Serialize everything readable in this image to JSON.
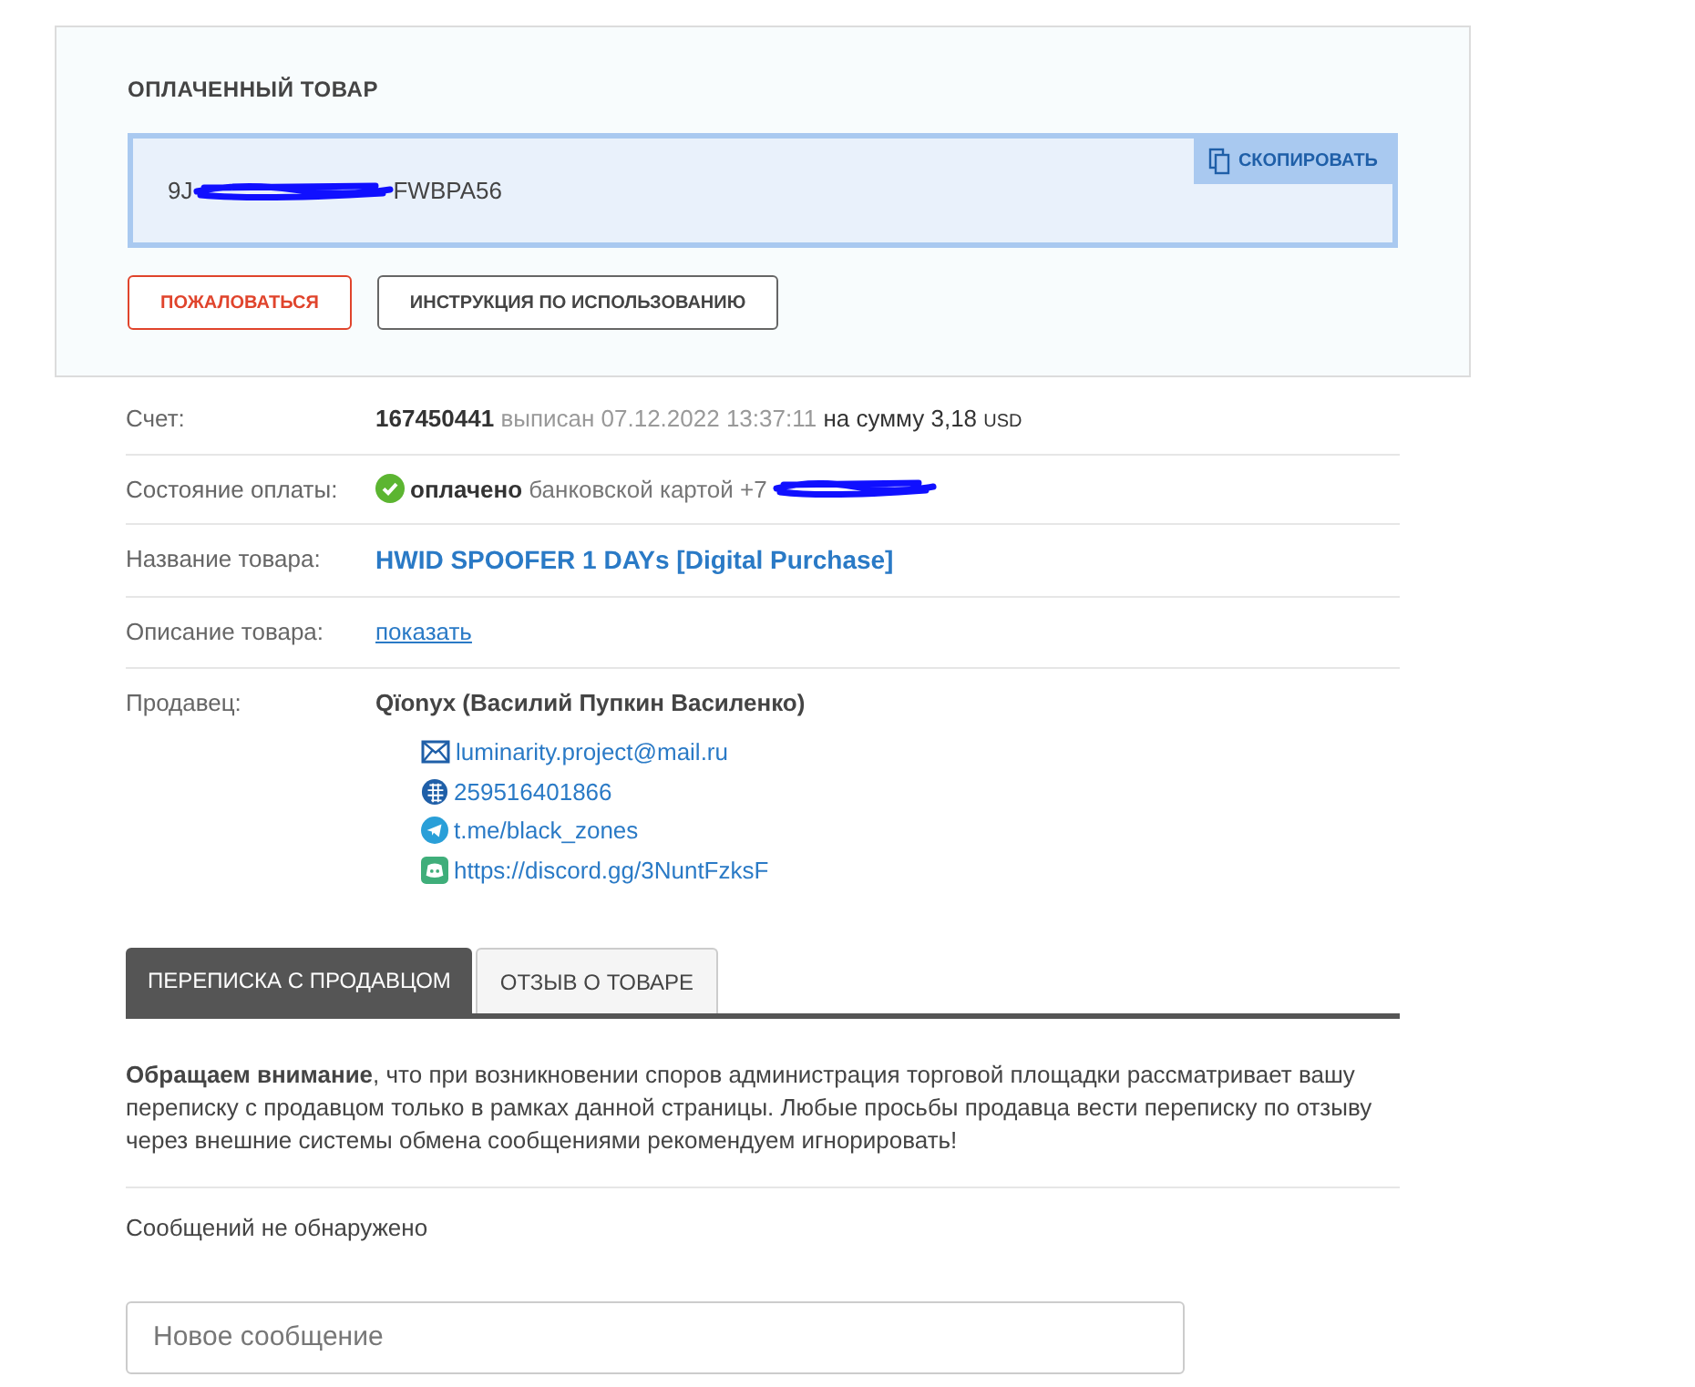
{
  "paid_item": {
    "title": "ОПЛАЧЕННЫЙ ТОВАР",
    "code_start": "9J",
    "code_end": "FWBPA56",
    "copy_button": "СКОПИРОВАТЬ",
    "buttons": [
      {
        "label": "ПОЖАЛОВАТЬСЯ",
        "kind": "danger"
      },
      {
        "label": "ИНСТРУКЦИЯ ПО ИСПОЛЬЗОВАНИЮ",
        "kind": "plain"
      }
    ]
  },
  "invoice": {
    "label": "Счет:",
    "number": "167450441",
    "issued": "выписан 07.12.2022 13:37:11",
    "sum_label": "на сумму 3,18",
    "currency": "USD"
  },
  "payment": {
    "label": "Состояние оплаты:",
    "status": "оплачено",
    "method": "банковской картой +7"
  },
  "product": {
    "label": "Название товара:",
    "name": "HWID SPOOFER 1 DAYs [Digital Purchase]"
  },
  "description": {
    "label": "Описание товара:",
    "link": "показать"
  },
  "seller": {
    "label": "Продавец:",
    "name": "Qïonyx (Василий Пупкин Василенко)",
    "contacts": [
      {
        "kind": "email",
        "text": "luminarity.project@mail.ru"
      },
      {
        "kind": "webmoney",
        "text": "259516401866"
      },
      {
        "kind": "telegram",
        "text": "t.me/black_zones"
      },
      {
        "kind": "discord",
        "text": "https://discord.gg/3NuntFzksF"
      }
    ]
  },
  "tabs": [
    {
      "label": "ПЕРЕПИСКА С ПРОДАВЦОМ",
      "selected": true
    },
    {
      "label": "ОТЗЫВ О ТОВАРЕ",
      "selected": false
    }
  ],
  "notice": "**Обращаем внимание**, что при возникновении споров администрация торговой площадки рассматривает вашу переписку с продавцом только в рамках данной страницы. Любые просьбы продавца вести переписку по отзыву через внешние системы обмена сообщениями рекомендуем игнорировать!",
  "messages_empty": "Сообщений не обнаружено",
  "new_message": {
    "placeholder": "Новое сообщение"
  }
}
